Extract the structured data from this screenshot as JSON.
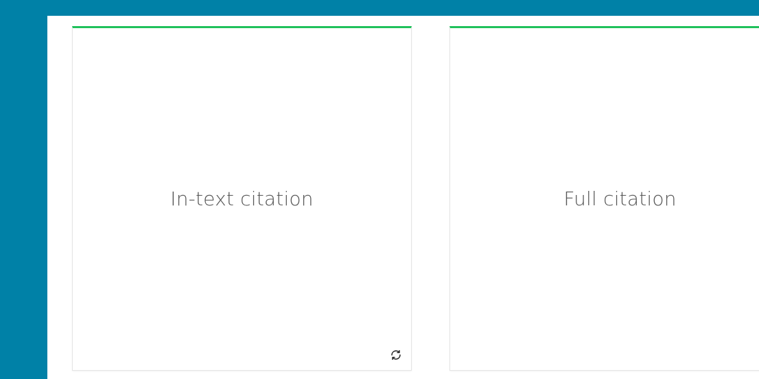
{
  "colors": {
    "background": "#0081a7",
    "panel": "#ffffff",
    "card_accent": "#1fc15b",
    "label_text": "#555555"
  },
  "cards": [
    {
      "label": "In-text citation",
      "action_icon": "refresh-icon"
    },
    {
      "label": "Full citation"
    }
  ]
}
